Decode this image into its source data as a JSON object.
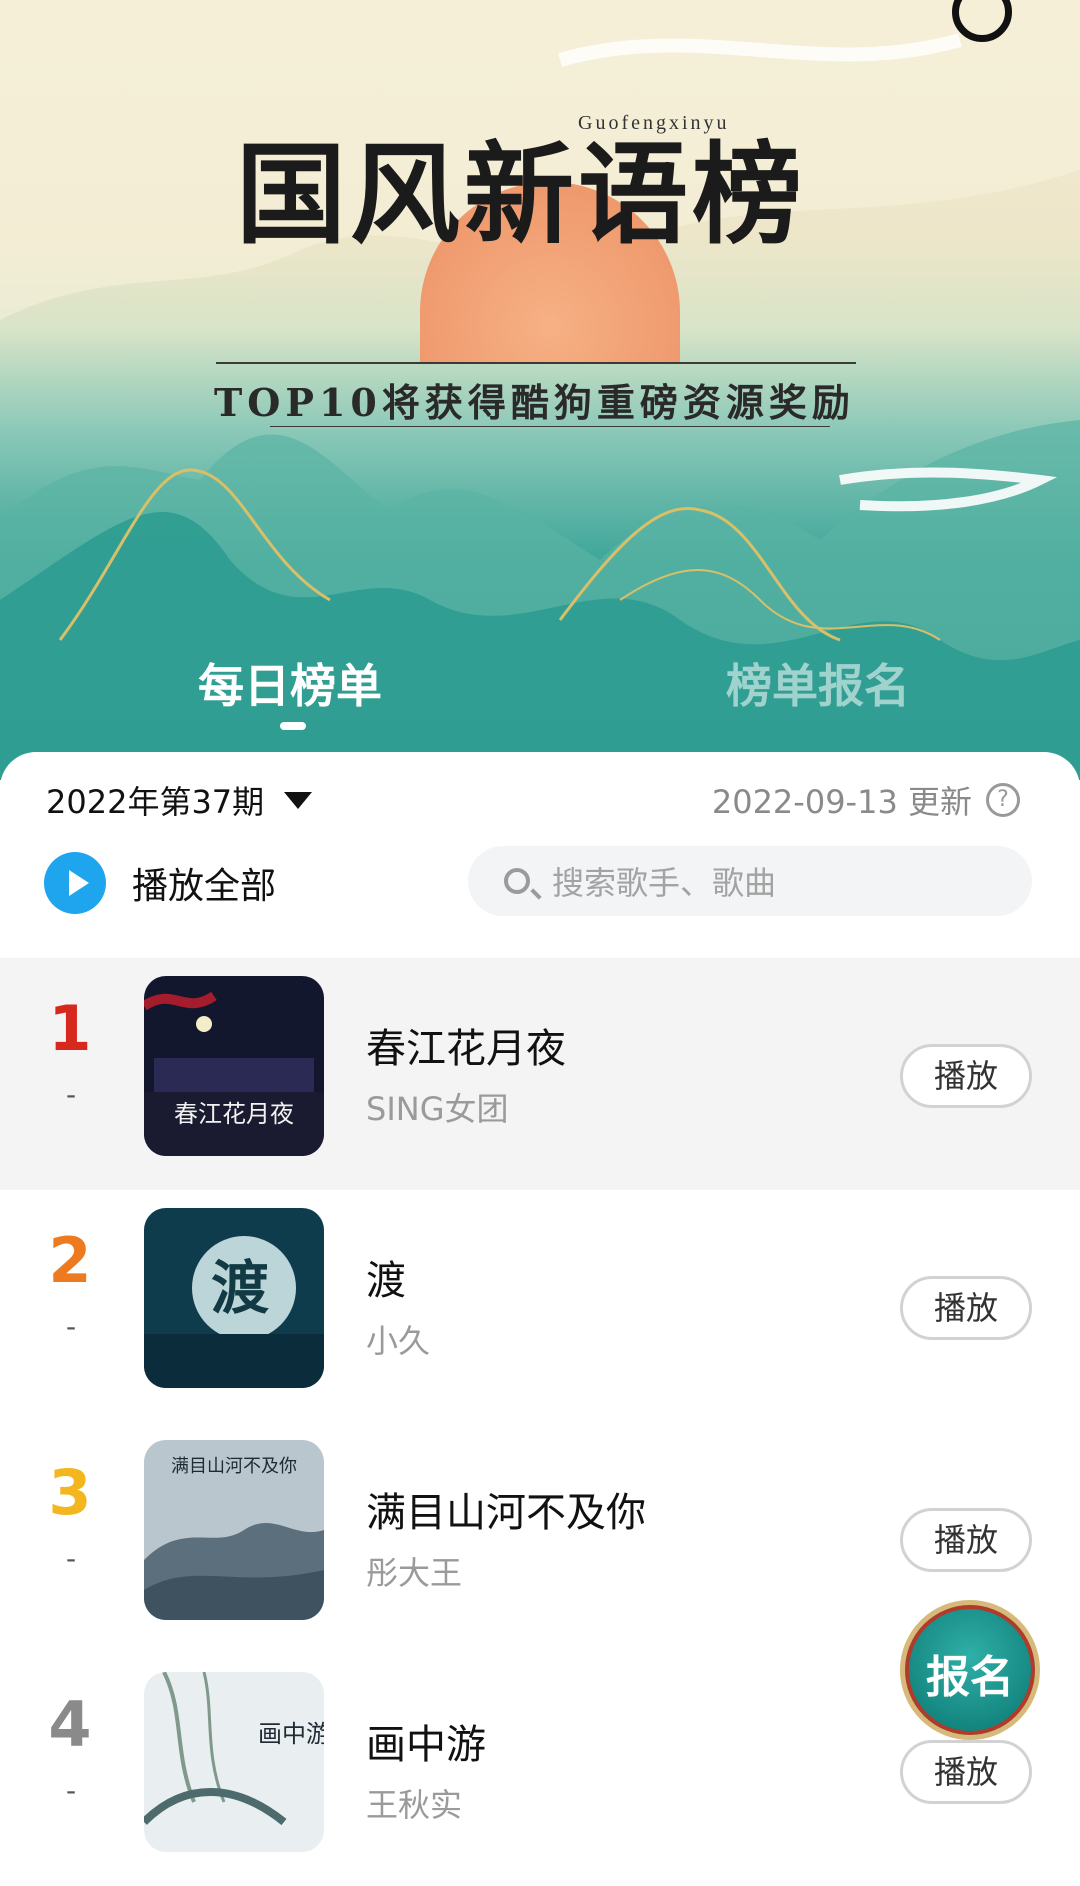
{
  "banner": {
    "logo_en": "Guofengxinyu",
    "logo_cn": "国风新语榜",
    "subtitle": "TOP10将获得酷狗重磅资源奖励",
    "tabs": [
      {
        "label": "每日榜单",
        "active": true
      },
      {
        "label": "榜单报名",
        "active": false
      }
    ]
  },
  "header": {
    "issue": "2022年第37期",
    "updated": "2022-09-13 更新"
  },
  "actions": {
    "play_all_label": "播放全部",
    "search_placeholder": "搜索歌手、歌曲"
  },
  "songs": [
    {
      "rank": "1",
      "trend": "-",
      "title": "春江花月夜",
      "artist": "SING女团",
      "play_label": "播放",
      "rank_color": "#d7281e",
      "cover_text": "春江花月夜"
    },
    {
      "rank": "2",
      "trend": "-",
      "title": "渡",
      "artist": "小久",
      "play_label": "播放",
      "rank_color": "#ee7a1f",
      "cover_text": "渡"
    },
    {
      "rank": "3",
      "trend": "-",
      "title": "满目山河不及你",
      "artist": "彤大王",
      "play_label": "播放",
      "rank_color": "#f3b61f",
      "cover_text": "满目山河不及你"
    },
    {
      "rank": "4",
      "trend": "-",
      "title": "画中游",
      "artist": "王秋实",
      "play_label": "播放",
      "rank_color": "#8a8a8a",
      "cover_text": "画中游"
    }
  ],
  "floating": {
    "signup_label": "报名"
  },
  "colors": {
    "accent": "#1ea5ee",
    "banner_teal": "#1f8f86"
  }
}
